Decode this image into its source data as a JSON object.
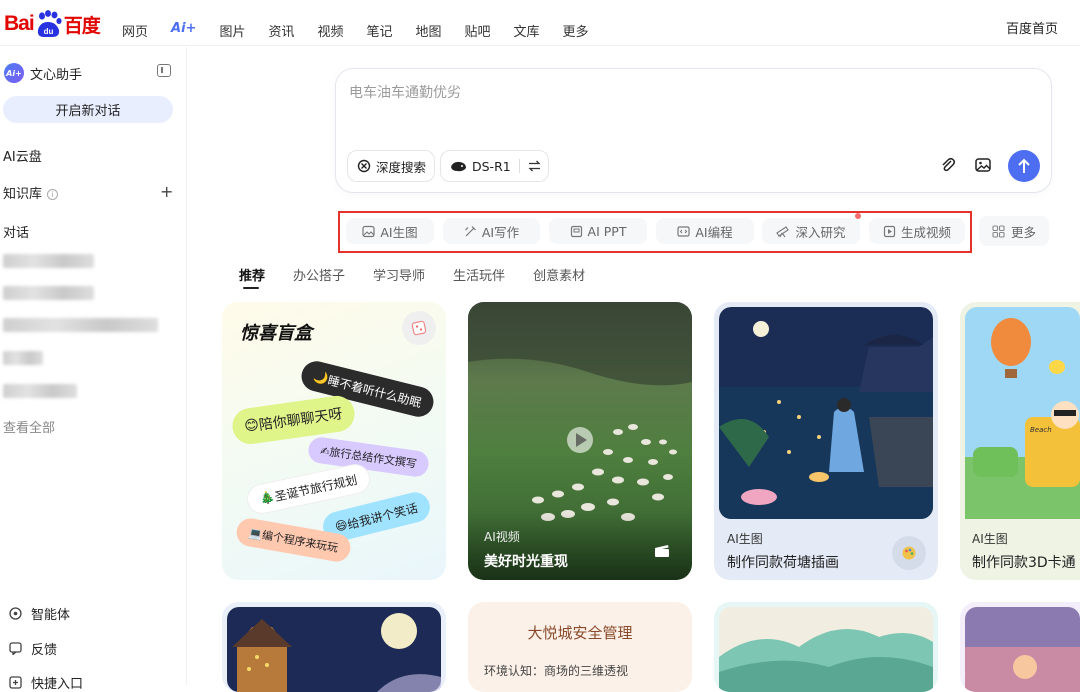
{
  "header": {
    "logo_text": "Bai",
    "logo_du": "du",
    "logo_cn": "百度",
    "nav": [
      "网页",
      "Ai+",
      "图片",
      "资讯",
      "视频",
      "笔记",
      "地图",
      "贴吧",
      "文库",
      "更多"
    ],
    "home_link": "百度首页"
  },
  "sidebar": {
    "assistant_name": "文心助手",
    "assistant_badge": "Ai+",
    "new_chat": "开启新对话",
    "cloud": "AI云盘",
    "knowledge": "知识库",
    "chats": "对话",
    "view_all": "查看全部",
    "bottom": [
      "智能体",
      "反馈",
      "快捷入口"
    ]
  },
  "search": {
    "placeholder": "电车油车通勤优劣",
    "deep_search": "深度搜索",
    "model": "DS-R1"
  },
  "tools": [
    "AI生图",
    "AI写作",
    "AI PPT",
    "AI编程",
    "深入研究",
    "生成视频"
  ],
  "more": "更多",
  "tabs": [
    "推荐",
    "办公搭子",
    "学习导师",
    "生活玩伴",
    "创意素材"
  ],
  "cards": {
    "c1": {
      "title": "惊喜盲盒",
      "bubbles": [
        "睡不着听什么助眠",
        "陪你聊聊天呀",
        "旅行总结作文撰写",
        "圣诞节旅行规划",
        "给我讲个笑话",
        "编个程序来玩玩"
      ]
    },
    "c2": {
      "label": "AI视频",
      "title": "美好时光重现"
    },
    "c3": {
      "label": "AI生图",
      "title": "制作同款荷塘插画"
    },
    "c4": {
      "label": "AI生图",
      "title": "制作同款3D卡通",
      "sign": "Beach"
    },
    "c6": {
      "title": "大悦城安全管理",
      "line": "环境认知：商场的三维透视"
    }
  },
  "colors": {
    "accent": "#4e6ef2",
    "brand_red": "#e10602",
    "highlight_border": "#e5322d"
  }
}
